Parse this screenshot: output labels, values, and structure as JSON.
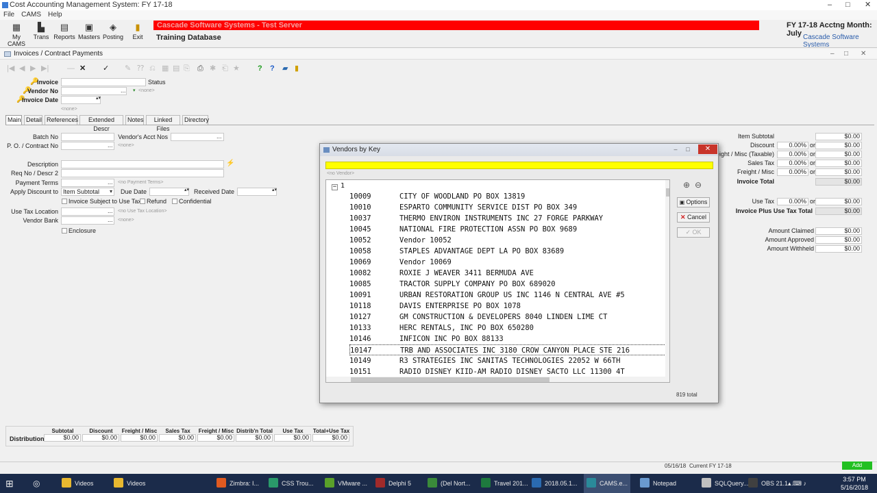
{
  "app": {
    "title": "Cost Accounting Management System: FY 17-18",
    "win_min": "–",
    "win_max": "□",
    "win_close": "✕"
  },
  "menu": [
    "File",
    "CAMS",
    "Help"
  ],
  "toolbar": [
    {
      "label": "My CAMS",
      "icon": "my-cams-icon",
      "glyph": "▦"
    },
    {
      "label": "Trans",
      "icon": "trans-icon",
      "glyph": "▙"
    },
    {
      "label": "Reports",
      "icon": "reports-icon",
      "glyph": "▤"
    },
    {
      "label": "Masters",
      "icon": "masters-icon",
      "glyph": "▣"
    },
    {
      "label": "Posting",
      "icon": "posting-icon",
      "glyph": "◈"
    },
    {
      "label": "Exit",
      "icon": "exit-icon",
      "glyph": "▮"
    }
  ],
  "banner": {
    "server": "Cascade Software Systems - Test Server",
    "database": "Training Database",
    "fiscal": "FY 17-18    Acctng Month: July",
    "company": "Cascade Software Systems"
  },
  "form": {
    "title": "Invoices / Contract Payments",
    "tools": [
      "|◀",
      "◀",
      "▶",
      "▶|",
      "—",
      "✕",
      "✓",
      "✎",
      "⁇",
      "⎌",
      "▦",
      "▤",
      "⎘",
      "⎙",
      "✱",
      "⎗",
      "★",
      "?",
      "?",
      "▰",
      "▮"
    ],
    "invoice_label": "Invoice",
    "status_label": "Status",
    "vendor_label": "Vendor No",
    "vendor_none": "<none>",
    "date_label": "Invoice Date",
    "date_none": "<none>",
    "ellipsis": "..."
  },
  "tabs": [
    "Main",
    "Detail",
    "References",
    "Extended Descr",
    "Notes",
    "Linked Files",
    "Directory"
  ],
  "main": {
    "batch_label": "Batch No",
    "acct_label": "Vendor's Acct Nos",
    "po_label": "P. O. / Contract No",
    "po_none": "<none>",
    "desc_label": "Description",
    "req_label": "Req No / Descr 2",
    "terms_label": "Payment Terms",
    "terms_none": "<no Payment Terms>",
    "apply_label": "Apply Discount to",
    "apply_value": "Item Subtotal",
    "due_label": "Due Date",
    "received_label": "Received Date",
    "cb_usetax": "Invoice Subject to Use Tax",
    "cb_refund": "Refund",
    "cb_conf": "Confidential",
    "utl_label": "Use Tax Location",
    "utl_none": "<no Use Tax Location>",
    "bank_label": "Vendor Bank",
    "bank_none": "<none>",
    "cb_enclosure": "Enclosure"
  },
  "totals": {
    "or": "or",
    "rows": [
      {
        "label": "Item Subtotal",
        "pct": "",
        "amt": "$0.00"
      },
      {
        "label": "Discount",
        "pct": "0.00%",
        "amt": "$0.00"
      },
      {
        "label": "Freight / Misc (Taxable)",
        "pct": "0.00%",
        "amt": "$0.00"
      },
      {
        "label": "Sales Tax",
        "pct": "0.00%",
        "amt": "$0.00"
      },
      {
        "label": "Freight / Misc",
        "pct": "0.00%",
        "amt": "$0.00"
      },
      {
        "label": "Invoice Total",
        "pct": "",
        "amt": "$0.00"
      }
    ],
    "usetax_label": "Use Tax",
    "usetax_pct": "0.00%",
    "usetax_amt": "$0.00",
    "plus_label": "Invoice Plus Use Tax Total",
    "plus_amt": "$0.00",
    "claimed_label": "Amount Claimed",
    "claimed": "$0.00",
    "approved_label": "Amount Approved",
    "approved": "$0.00",
    "withheld_label": "Amount Withheld",
    "withheld": "$0.00"
  },
  "distribution": {
    "label": "Distribution",
    "headers": [
      "Subtotal",
      "Discount",
      "Freight / Misc",
      "Sales Tax",
      "Freight / Misc",
      "Distrib'n Total",
      "Use Tax",
      "Total+Use Tax"
    ],
    "values": [
      "$0.00",
      "$0.00",
      "$0.00",
      "$0.00",
      "$0.00",
      "$0.00",
      "$0.00",
      "$0.00"
    ]
  },
  "statusbar": {
    "date": "05/16/18",
    "fy": "Current FY 17-18",
    "mode": "Add"
  },
  "dialog": {
    "title": "Vendors by Key",
    "no_vendor": "<no Vendor>",
    "root": "1",
    "rows": [
      {
        "code": "10009",
        "name": "CITY OF WOODLAND PO BOX 13819"
      },
      {
        "code": "10010",
        "name": "ESPARTO COMMUNITY SERVICE DIST PO BOX 349"
      },
      {
        "code": "10037",
        "name": "THERMO ENVIRON INSTRUMENTS INC 27 FORGE PARKWAY"
      },
      {
        "code": "10045",
        "name": "NATIONAL FIRE PROTECTION ASSN PO BOX 9689"
      },
      {
        "code": "10052",
        "name": "Vendor 10052"
      },
      {
        "code": "10058",
        "name": "STAPLES ADVANTAGE DEPT LA PO BOX 83689"
      },
      {
        "code": "10069",
        "name": "Vendor 10069"
      },
      {
        "code": "10082",
        "name": "ROXIE J WEAVER 3411 BERMUDA AVE"
      },
      {
        "code": "10085",
        "name": "TRACTOR SUPPLY COMPANY PO BOX 689020"
      },
      {
        "code": "10091",
        "name": "URBAN RESTORATION GROUP US INC 1146 N CENTRAL AVE #5"
      },
      {
        "code": "10118",
        "name": "DAVIS ENTERPRISE PO BOX 1078"
      },
      {
        "code": "10127",
        "name": "GM CONSTRUCTION & DEVELOPERS 8040 LINDEN LIME CT"
      },
      {
        "code": "10133",
        "name": "HERC RENTALS, INC PO BOX 650280"
      },
      {
        "code": "10146",
        "name": "INFICON INC PO BOX 88133"
      },
      {
        "code": "10147",
        "name": "TRB AND ASSOCIATES INC 3180 CROW CANYON PLACE STE 216"
      },
      {
        "code": "10149",
        "name": "R3 STRATEGIES INC SANITAS TECHNOLOGIES 22052 W 66TH"
      },
      {
        "code": "10151",
        "name": "RADIO DISNEY KIID-AM RADIO DISNEY SACTO LLC 11300 4T"
      }
    ],
    "selected_index": 14,
    "options_label": "Options",
    "cancel_label": "Cancel",
    "ok_label": "OK",
    "total_label": "819 total"
  },
  "taskbar": [
    {
      "label": "Videos",
      "color": "#e8b830"
    },
    {
      "label": "Videos",
      "color": "#e8b830"
    },
    {
      "label": "Zimbra: I...",
      "color": "#e05a20"
    },
    {
      "label": "CSS Trou...",
      "color": "#2a9a6a"
    },
    {
      "label": "VMware ...",
      "color": "#5aa02a"
    },
    {
      "label": "Delphi 5",
      "color": "#a02a2a"
    },
    {
      "label": "(Del Nort...",
      "color": "#3a8a3a"
    },
    {
      "label": "Travel 201...",
      "color": "#1e7a3e"
    },
    {
      "label": "2018.05.1...",
      "color": "#2a6ab0"
    },
    {
      "label": "CAMS.e...",
      "color": "#2a8a9a"
    },
    {
      "label": "Notepad",
      "color": "#6a9ad0"
    },
    {
      "label": "SQLQuery...",
      "color": "#c0c0c0"
    },
    {
      "label": "OBS 21.1...",
      "color": "#404040"
    }
  ],
  "clock": {
    "time": "3:57 PM",
    "date": "5/16/2018"
  }
}
